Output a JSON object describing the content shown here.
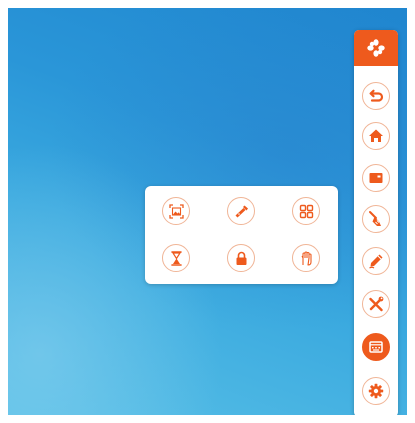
{
  "colors": {
    "accent": "#ee5a1d",
    "ring": "#f0b597",
    "panel": "#ffffff",
    "desktop_top": "#1f86cf",
    "desktop_bottom": "#57bfe6"
  },
  "toolbar": {
    "header_icon": "flower-logo-icon",
    "buttons": [
      {
        "name": "back-button",
        "icon": "back-arrow-icon",
        "active": false
      },
      {
        "name": "home-button",
        "icon": "home-icon",
        "active": false
      },
      {
        "name": "window-button",
        "icon": "window-icon",
        "active": false
      },
      {
        "name": "clear-button",
        "icon": "broom-icon",
        "active": false
      },
      {
        "name": "annotate-button",
        "icon": "pen-icon",
        "active": false
      },
      {
        "name": "tools-button",
        "icon": "wrench-screwdriver-icon",
        "active": false
      },
      {
        "name": "keyboard-panel-button",
        "icon": "keyboard-window-icon",
        "active": true
      },
      {
        "name": "settings-button",
        "icon": "gear-icon",
        "active": false
      }
    ]
  },
  "popup": {
    "buttons": [
      {
        "name": "screenshot-button",
        "icon": "screenshot-frame-icon"
      },
      {
        "name": "spotlight-button",
        "icon": "flashlight-icon"
      },
      {
        "name": "apps-button",
        "icon": "app-grid-icon"
      },
      {
        "name": "timer-button",
        "icon": "hourglass-icon"
      },
      {
        "name": "lock-button",
        "icon": "lock-icon"
      },
      {
        "name": "vote-button",
        "icon": "hand-raise-icon"
      }
    ]
  }
}
